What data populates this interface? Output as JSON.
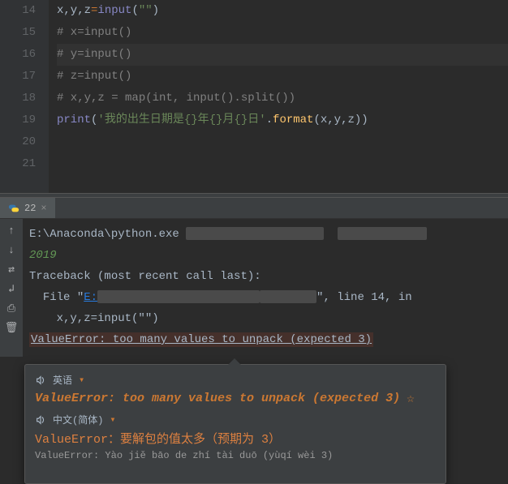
{
  "editor": {
    "lines": {
      "14": {
        "var": "x,y,z",
        "op": "=",
        "fn": "input",
        "str": "\"\""
      },
      "15": "# x=input()",
      "16": "# y=input()",
      "17": "# z=input()",
      "18": "# x,y,z = map(int, input().split())",
      "19": {
        "print": "print",
        "str": "'我的出生日期是{}年{}月{}日'",
        "fmt": "format",
        "args": "x,y,z"
      }
    },
    "line_numbers": [
      "14",
      "15",
      "16",
      "17",
      "18",
      "19",
      "20",
      "21"
    ]
  },
  "run": {
    "tab_label": "22",
    "exec_path": "E:\\Anaconda\\python.exe",
    "user_input": "2019",
    "traceback_header": "Traceback (most recent call last):",
    "file_label": "File \"",
    "file_prefix": "E:",
    "line_ref": "\", line 14, in",
    "code_line": "    x,y,z=input(\"\")",
    "error_line": "ValueError: too many values to unpack (expected 3)"
  },
  "toolbar": {
    "up": "↑",
    "down": "↓",
    "filter": "⇄",
    "wrap": "↲",
    "print": "⎙",
    "trash": "🗑"
  },
  "translation": {
    "lang_src": "英语",
    "arrow": "▾",
    "source_text": "ValueError: too many values to unpack (expected 3)",
    "star": "☆",
    "lang_tgt": "中文(简体)",
    "target_text": "ValueError：要解包的值太多（预期为 3）",
    "pinyin": "ValueError: Yào jiě bāo de zhí tài duō (yùqí wèi 3)"
  }
}
